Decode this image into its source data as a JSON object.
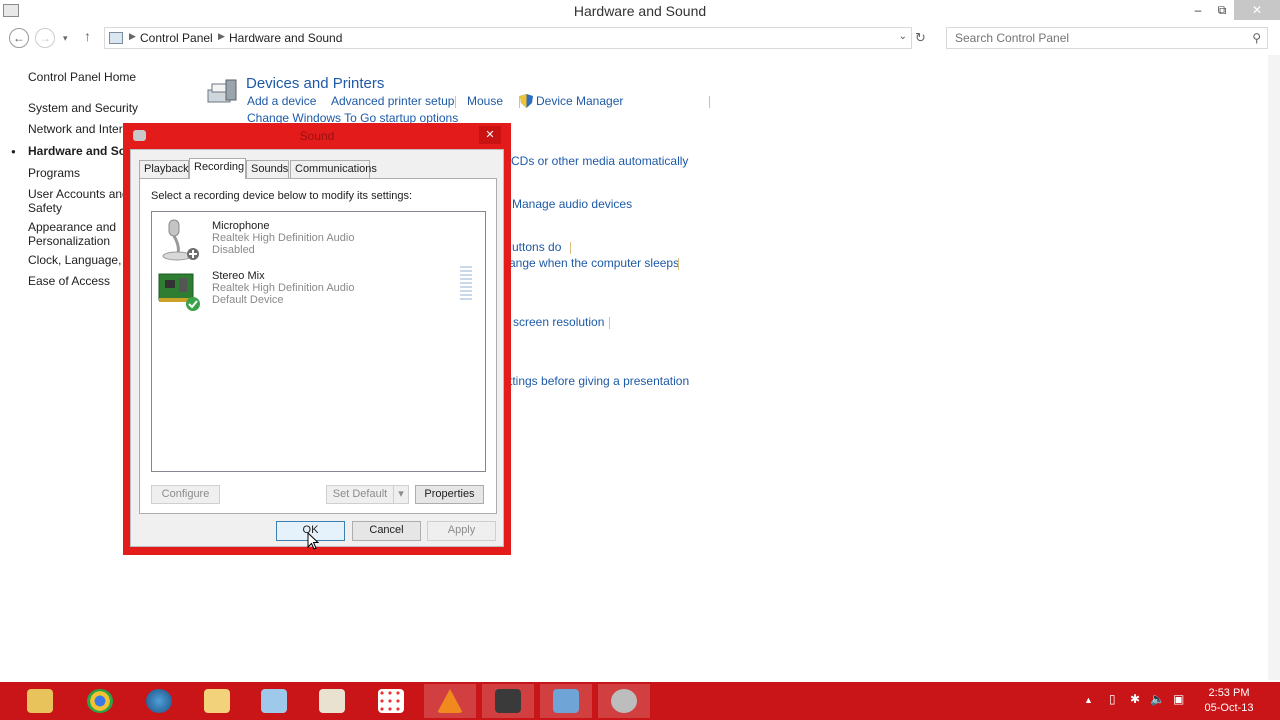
{
  "window": {
    "title": "Hardware and Sound",
    "controls": {
      "minimize": "‒",
      "restore": "⧉",
      "close": "✕"
    }
  },
  "address_bar": {
    "breadcrumb": [
      "Control Panel",
      "Hardware and Sound"
    ],
    "search_placeholder": "Search Control Panel"
  },
  "left_nav": {
    "items": [
      {
        "label": "Control Panel Home",
        "active": false
      },
      {
        "label": "System and Security",
        "active": false
      },
      {
        "label": "Network and Internet",
        "active": false
      },
      {
        "label": "Hardware and Sound",
        "active": true
      },
      {
        "label": "Programs",
        "active": false
      },
      {
        "label": "User Accounts and Family Safety",
        "active": false
      },
      {
        "label": "Appearance and Personalization",
        "active": false
      },
      {
        "label": "Clock, Language, and Region",
        "active": false
      },
      {
        "label": "Ease of Access",
        "active": false
      }
    ],
    "lines": {
      "user_accounts_1": "User Accounts and",
      "user_accounts_2": "Safety",
      "appearance_1": "Appearance and",
      "appearance_2": "Personalization",
      "clock": "Clock, Language, a",
      "network": "Network and Intern",
      "hardware": "Hardware and Sou"
    }
  },
  "main": {
    "devices_printers": {
      "title": "Devices and Printers",
      "links": {
        "add_device": "Add a device",
        "advanced_printer": "Advanced printer setup",
        "mouse": "Mouse",
        "device_manager": "Device Manager",
        "change_windows_to_go": "Change Windows To Go startup options"
      }
    },
    "partial_links": {
      "autoplay": "CDs or other media automatically",
      "sound": "Manage audio devices",
      "power_buttons": "uttons do",
      "power_sleep": "ange when the computer sleeps",
      "display": "screen resolution",
      "presentation": "ttings before giving a presentation"
    }
  },
  "sound_dialog": {
    "title": "Sound",
    "tabs": [
      "Playback",
      "Recording",
      "Sounds",
      "Communications"
    ],
    "active_tab": "Recording",
    "instruction": "Select a recording device below to modify its settings:",
    "devices": [
      {
        "name": "Microphone",
        "driver": "Realtek High Definition Audio",
        "state": "Disabled",
        "icon": "microphone-icon"
      },
      {
        "name": "Stereo Mix",
        "driver": "Realtek High Definition Audio",
        "state": "Default Device",
        "icon": "sound-card-icon"
      }
    ],
    "buttons": {
      "configure": "Configure",
      "set_default": "Set Default",
      "set_default_arrow": "▾",
      "properties": "Properties",
      "ok": "OK",
      "cancel": "Cancel",
      "apply": "Apply"
    },
    "highlight_color": "#e31b1b"
  },
  "taskbar": {
    "color": "#c91518",
    "apps": [
      "file-explorer-icon",
      "chrome-icon",
      "globe-icon",
      "folder-icon",
      "notes-icon",
      "paint-icon",
      "apps-icon",
      "vlc-icon",
      "camera-icon",
      "network-icon",
      "sound-icon"
    ],
    "clock": {
      "time": "2:53 PM",
      "date": "05-Oct-13"
    }
  }
}
